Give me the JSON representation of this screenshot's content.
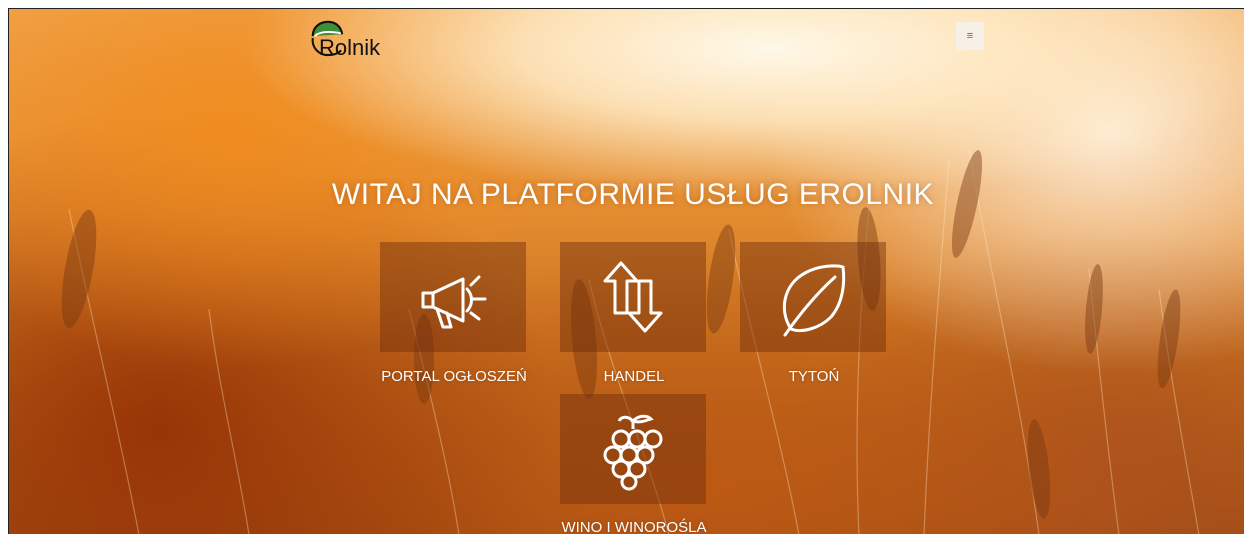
{
  "brand": {
    "logo_text": "Rolnik",
    "logo_alt": "eRolnik logo"
  },
  "header": {
    "menu_icon": "hamburger-menu-icon",
    "menu_glyph": "≡"
  },
  "hero": {
    "headline": "WITAJ NA PLATFORMIE USŁUG EROLNIK"
  },
  "tiles": [
    {
      "label": "PORTAL OGŁOSZEŃ",
      "icon": "megaphone-icon"
    },
    {
      "label": "HANDEL",
      "icon": "up-down-arrows-icon"
    },
    {
      "label": "TYTOŃ",
      "icon": "leaf-icon"
    },
    {
      "label": "WINO I WINOROŚLA",
      "icon": "grapes-icon"
    }
  ],
  "colors": {
    "tile_overlay": "#6e2d0a",
    "text": "#ffffff",
    "logo_green": "#3f8f3a"
  }
}
